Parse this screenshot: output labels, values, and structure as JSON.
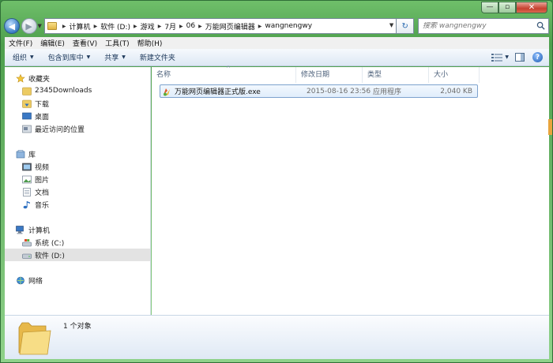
{
  "window": {
    "caption": {
      "minimize": "—",
      "maximize": "▫",
      "close": "✕"
    }
  },
  "address": {
    "crumbs": [
      "计算机",
      "软件 (D:)",
      "游戏",
      "7月",
      "06",
      "万能网页编辑器",
      "wangnengwy"
    ],
    "search_placeholder": "搜索 wangnengwy"
  },
  "menu": [
    "文件(F)",
    "编辑(E)",
    "查看(V)",
    "工具(T)",
    "帮助(H)"
  ],
  "commands": {
    "organize": "组织",
    "include_in_library": "包含到库中",
    "share": "共享",
    "new_folder": "新建文件夹"
  },
  "nav": {
    "favorites": {
      "label": "收藏夹",
      "items": [
        "2345Downloads",
        "下载",
        "桌面",
        "最近访问的位置"
      ]
    },
    "libraries": {
      "label": "库",
      "items": [
        "视频",
        "图片",
        "文档",
        "音乐"
      ]
    },
    "computer": {
      "label": "计算机",
      "items": [
        "系统 (C:)",
        "软件 (D:)"
      ]
    },
    "network": {
      "label": "网络"
    }
  },
  "columns": {
    "name": "名称",
    "date": "修改日期",
    "type": "类型",
    "size": "大小"
  },
  "files": [
    {
      "name": "万能网页编辑器正式版.exe",
      "date": "2015-08-16 23:56",
      "type": "应用程序",
      "size": "2,040 KB"
    }
  ],
  "status": {
    "count": "1 个对象"
  },
  "colors": {
    "window_frame": "#4e9f4d",
    "selection_border": "#7da2ce",
    "command_text": "#1e395b"
  }
}
